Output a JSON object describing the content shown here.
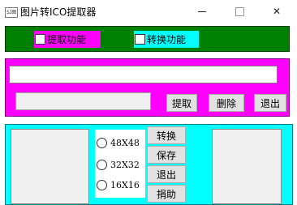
{
  "window": {
    "icon_text": "SJ图",
    "title": "图片转ICO提取器",
    "close_glyph": "✕"
  },
  "features": {
    "extract_label": "提取功能",
    "convert_label": "转换功能"
  },
  "extract_panel": {
    "path_value": "",
    "name_value": "",
    "extract_button": "提取",
    "delete_button": "删除",
    "exit_button": "退出"
  },
  "convert_panel": {
    "sizes": [
      "48X48",
      "32X32",
      "16X16"
    ],
    "convert_button": "转换",
    "save_button": "保存",
    "exit_button": "退出",
    "donate_button": "捐助"
  }
}
